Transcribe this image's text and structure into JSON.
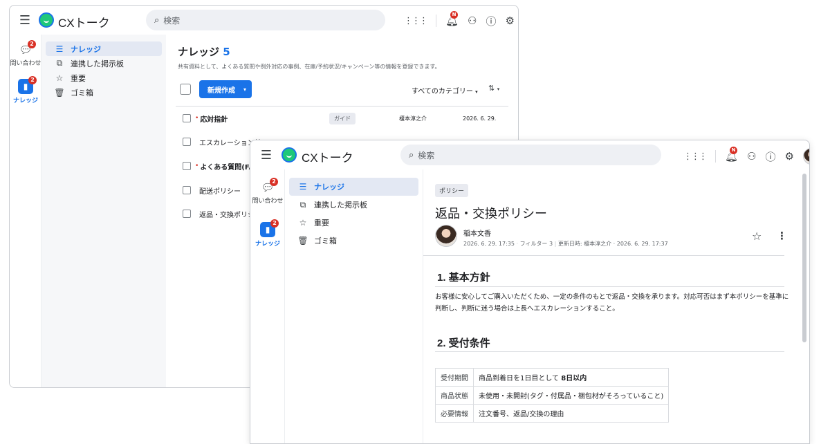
{
  "app": {
    "brand": "CXトーク",
    "search_placeholder": "検索",
    "bell_badge": "N"
  },
  "rail": [
    {
      "label": "問い合わせ",
      "badge": "2"
    },
    {
      "label": "ナレッジ",
      "badge": "2"
    }
  ],
  "nav": [
    "ナレッジ",
    "連携した掲示板",
    "重要",
    "ゴミ箱"
  ],
  "list": {
    "title": "ナレッジ",
    "count": "5",
    "description": "共有資料として、よくある質問や例外対応の事例、在庫/予約状況/キャンペーン等の情報を登録できます。",
    "new_button": "新規作成",
    "category_filter": "すべてのカテゴリー",
    "rows": [
      {
        "title": "応対指針",
        "required": true,
        "tag": "ガイド",
        "author": "榎本淳之介",
        "date": "2026. 6. 29."
      },
      {
        "title": "エスカレーション基",
        "required": false,
        "tag": "",
        "author": "",
        "date": ""
      },
      {
        "title": "よくある質問(FAC",
        "required": true,
        "tag": "",
        "author": "",
        "date": ""
      },
      {
        "title": "配送ポリシー",
        "required": false,
        "tag": "",
        "author": "",
        "date": ""
      },
      {
        "title": "返品・交換ポリシ",
        "required": false,
        "tag": "",
        "author": "",
        "date": ""
      }
    ]
  },
  "detail": {
    "category_tag": "ポリシー",
    "title": "返品・交換ポリシー",
    "author": "稲本文香",
    "created": "2026. 6. 29. 17:35",
    "filter": "フィルター 3",
    "updated": "更新日時: 榎本淳之介 · 2026. 6. 29. 17:37",
    "section1_title": "1. 基本方針",
    "section1_body": "お客様に安心してご購入いただくため、一定の条件のもとで返品・交換を承ります。対応可否はまず本ポリシーを基準に判断し、判断に迷う場合は上長へエスカレーションすること。",
    "section2_title": "2. 受付条件",
    "conditions": [
      {
        "key": "受付期間",
        "value_prefix": "商品到着日を1日目として ",
        "value_bold": "8日以内"
      },
      {
        "key": "商品状態",
        "value_prefix": "未使用・未開封(タグ・付属品・梱包材がそろっていること)",
        "value_bold": ""
      },
      {
        "key": "必要情報",
        "value_prefix": "注文番号、返品/交換の理由",
        "value_bold": ""
      }
    ]
  }
}
